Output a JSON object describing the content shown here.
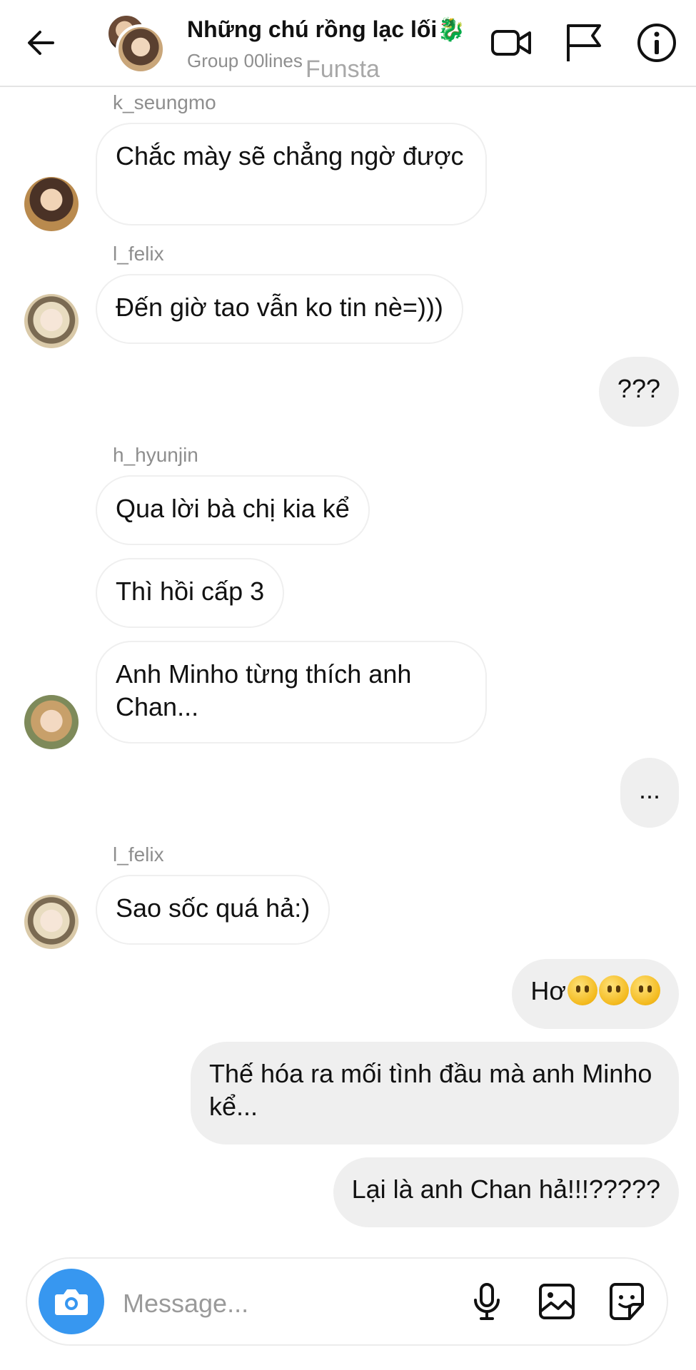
{
  "header": {
    "back_icon": "back-arrow-icon",
    "title": "Những chú rồng lạc lối",
    "title_emoji": "🐉",
    "subtitle": "Group 00lines",
    "watermark": "Funsta",
    "icons": [
      "video-call-icon",
      "flag-icon",
      "info-icon"
    ]
  },
  "messages": [
    {
      "sender": "k_seungmo",
      "side": "in",
      "text": "Chắc mày sẽ chẳng ngờ được"
    },
    {
      "sender": "l_felix",
      "side": "in",
      "text": "Đến giờ tao vẫn ko tin nè=)))"
    },
    {
      "sender": "me",
      "side": "out",
      "text": "???"
    },
    {
      "sender": "h_hyunjin",
      "side": "in",
      "text": "Qua lời bà chị kia kể"
    },
    {
      "sender": "h_hyunjin",
      "side": "in",
      "text": "Thì hồi cấp 3"
    },
    {
      "sender": "h_hyunjin",
      "side": "in",
      "text": "Anh Minho từng thích anh Chan..."
    },
    {
      "sender": "me",
      "side": "out",
      "text": "..."
    },
    {
      "sender": "l_felix",
      "side": "in",
      "text": "Sao sốc quá hả:)"
    },
    {
      "sender": "me",
      "side": "out",
      "text": "Hơ",
      "emoji_count": 3
    },
    {
      "sender": "me",
      "side": "out",
      "text": "Thế hóa ra mối tình đầu mà anh Minho kể..."
    },
    {
      "sender": "me",
      "side": "out",
      "text": "Lại là anh Chan hả!!!?????"
    }
  ],
  "usernames": {
    "k_seungmo": "k_seungmo",
    "l_felix": "l_felix",
    "h_hyunjin": "h_hyunjin"
  },
  "composer": {
    "placeholder": "Message...",
    "icons": [
      "camera-icon",
      "microphone-icon",
      "gallery-icon",
      "sticker-icon"
    ]
  },
  "colors": {
    "accent": "#3797f0",
    "outgoing_bubble": "#efefef",
    "incoming_border": "#efefef",
    "muted_text": "#8e8e8e"
  }
}
